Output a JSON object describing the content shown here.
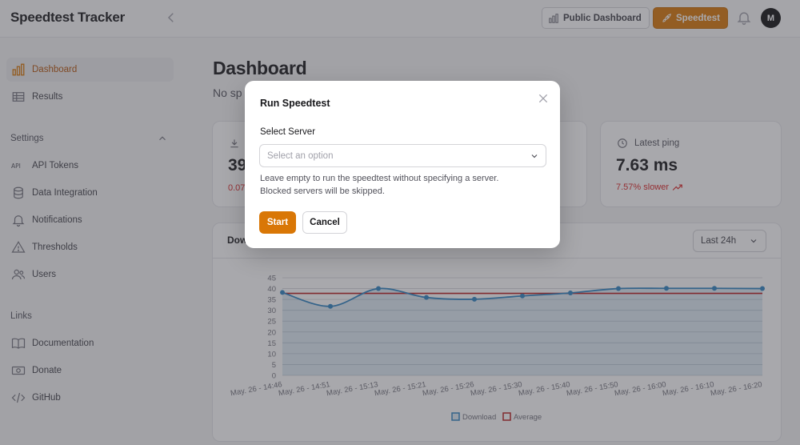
{
  "header": {
    "brand": "Speedtest Tracker",
    "public_dashboard_label": "Public Dashboard",
    "speedtest_label": "Speedtest",
    "avatar_initial": "M"
  },
  "sidebar": {
    "items": [
      {
        "label": "Dashboard",
        "icon": "bar-chart-icon",
        "active": true
      },
      {
        "label": "Results",
        "icon": "table-icon",
        "active": false
      }
    ],
    "settings_heading": "Settings",
    "settings_items": [
      {
        "label": "API Tokens",
        "icon": "api-icon"
      },
      {
        "label": "Data Integration",
        "icon": "database-icon"
      },
      {
        "label": "Notifications",
        "icon": "bell-icon"
      },
      {
        "label": "Thresholds",
        "icon": "warning-icon"
      },
      {
        "label": "Users",
        "icon": "users-icon"
      }
    ],
    "links_heading": "Links",
    "links_items": [
      {
        "label": "Documentation",
        "icon": "book-icon"
      },
      {
        "label": "Donate",
        "icon": "money-icon"
      },
      {
        "label": "GitHub",
        "icon": "code-icon"
      }
    ]
  },
  "main": {
    "title": "Dashboard",
    "subtitle_visible": "No sp",
    "card_download": {
      "value_visible": "39",
      "change_visible": "0.07"
    },
    "card_ping": {
      "label": "Latest ping",
      "value": "7.63 ms",
      "change": "7.57% slower"
    },
    "chart_card": {
      "title_visible": "Dow",
      "range_label": "Last 24h"
    }
  },
  "chart_data": {
    "type": "line",
    "title": "",
    "x": [
      "May. 26 - 14:46",
      "May. 26 - 14:51",
      "May. 26 - 15:13",
      "May. 26 - 15:21",
      "May. 26 - 15:26",
      "May. 26 - 15:30",
      "May. 26 - 15:40",
      "May. 26 - 15:50",
      "May. 26 - 16:00",
      "May. 26 - 16:10",
      "May. 26 - 16:20"
    ],
    "series": [
      {
        "name": "Download",
        "values": [
          38.2,
          31.8,
          40.0,
          35.9,
          35.1,
          36.6,
          38.0,
          40.0,
          40.1,
          40.1,
          40.0
        ],
        "color": "#2f84c2"
      },
      {
        "name": "Average",
        "values": [
          37.8,
          37.8,
          37.8,
          37.8,
          37.8,
          37.8,
          37.8,
          37.8,
          37.8,
          37.8,
          37.8
        ],
        "color": "#b91c1c"
      }
    ],
    "ylim": [
      0,
      45
    ],
    "yticks": [
      0,
      5,
      10,
      15,
      20,
      25,
      30,
      35,
      40,
      45
    ],
    "grid": true,
    "legend": "bottom-center"
  },
  "modal": {
    "title": "Run Speedtest",
    "field_label": "Select Server",
    "select_placeholder": "Select an option",
    "help_line1": "Leave empty to run the speedtest without specifying a server.",
    "help_line2": "Blocked servers will be skipped.",
    "start_label": "Start",
    "cancel_label": "Cancel"
  },
  "colors": {
    "accent": "#d97706",
    "danger": "#dc2626"
  }
}
